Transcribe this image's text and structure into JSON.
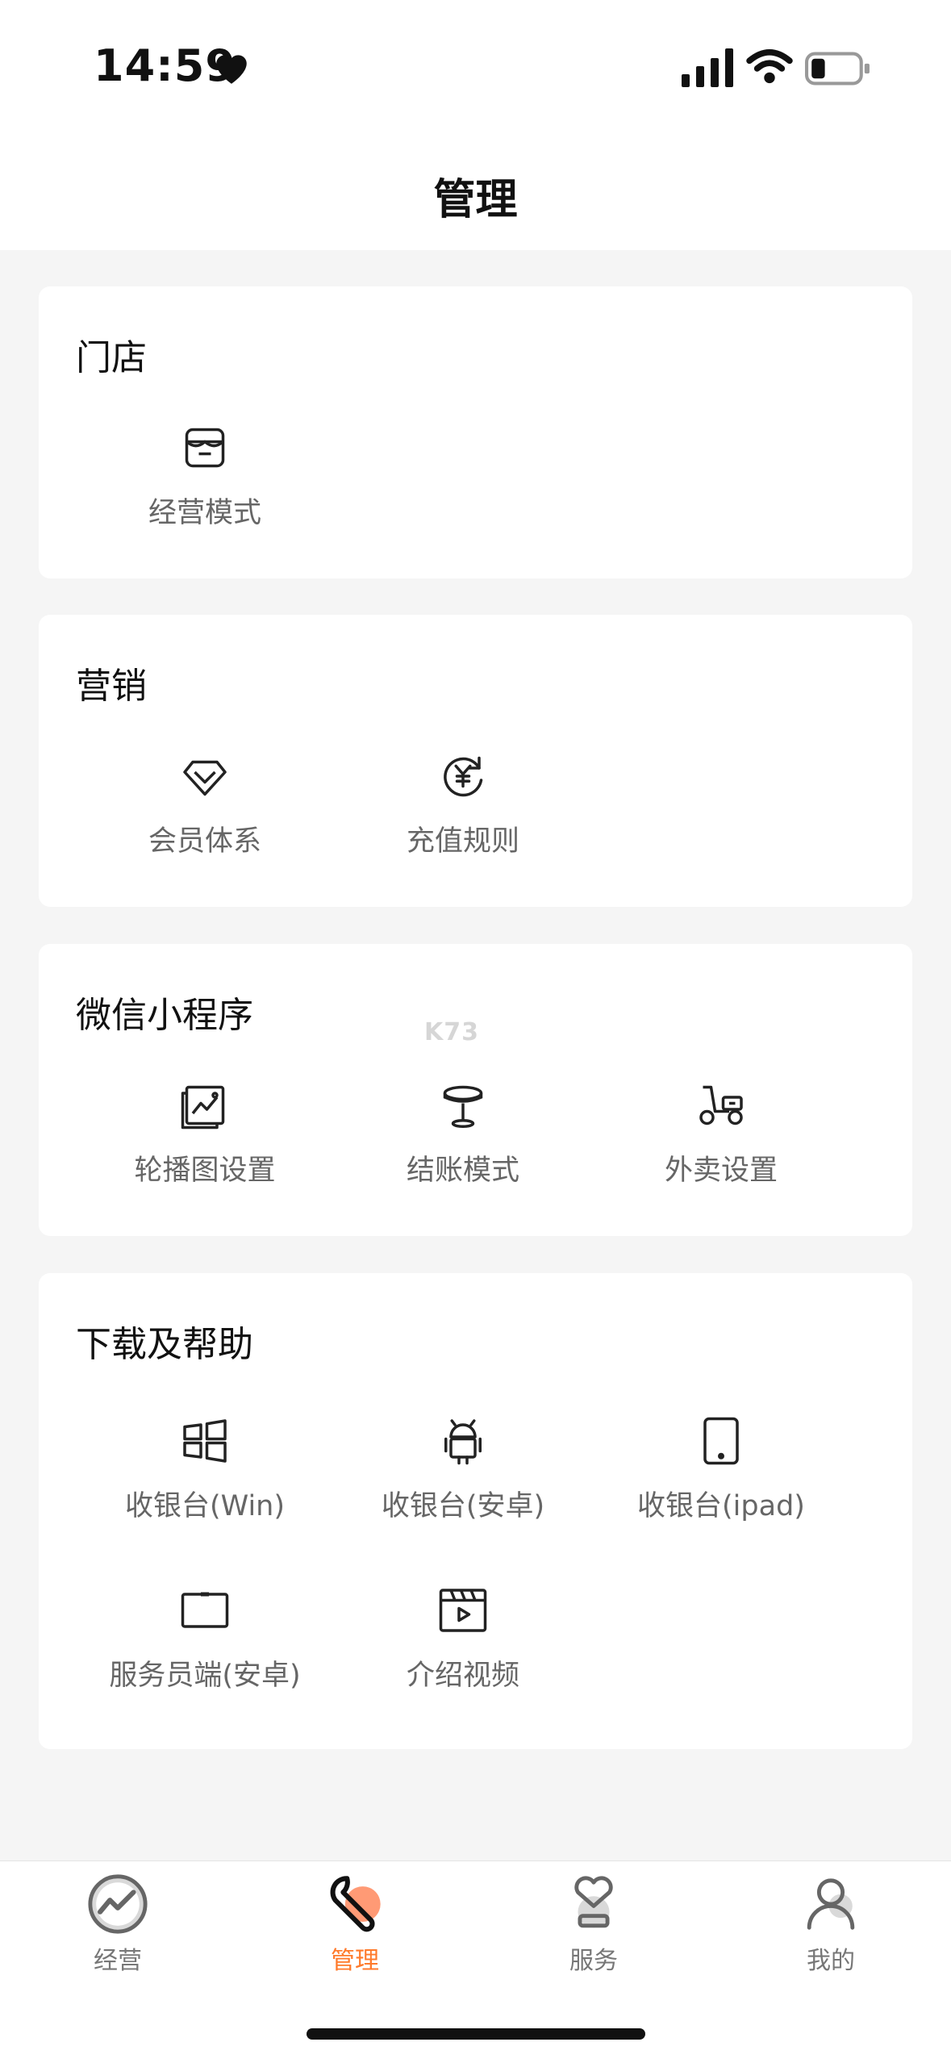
{
  "status_bar": {
    "time": "14:59"
  },
  "header": {
    "title": "管理"
  },
  "sections": [
    {
      "title": "门店",
      "items": [
        {
          "label": "经营模式",
          "icon": "store-icon"
        }
      ]
    },
    {
      "title": "营销",
      "items": [
        {
          "label": "会员体系",
          "icon": "diamond-icon"
        },
        {
          "label": "充值规则",
          "icon": "yen-refresh-icon"
        }
      ]
    },
    {
      "title": "微信小程序",
      "items": [
        {
          "label": "轮播图设置",
          "icon": "image-chart-icon"
        },
        {
          "label": "结账模式",
          "icon": "table-icon"
        },
        {
          "label": "外卖设置",
          "icon": "scooter-icon"
        }
      ]
    },
    {
      "title": "下载及帮助",
      "items": [
        {
          "label": "收银台(Win)",
          "icon": "windows-icon"
        },
        {
          "label": "收银台(安卓)",
          "icon": "android-icon"
        },
        {
          "label": "收银台(ipad)",
          "icon": "tablet-icon"
        },
        {
          "label": "服务员端(安卓)",
          "icon": "monitor-icon"
        },
        {
          "label": "介绍视频",
          "icon": "video-icon"
        }
      ]
    }
  ],
  "watermark": "K73",
  "tabs": [
    {
      "label": "经营",
      "icon": "chart-circle-icon",
      "active": false
    },
    {
      "label": "管理",
      "icon": "wrench-icon",
      "active": true
    },
    {
      "label": "服务",
      "icon": "heart-hand-icon",
      "active": false
    },
    {
      "label": "我的",
      "icon": "user-icon",
      "active": false
    }
  ],
  "colors": {
    "accent": "#ff7a2b",
    "background": "#f5f5f5",
    "card": "#ffffff",
    "label": "#666666"
  }
}
